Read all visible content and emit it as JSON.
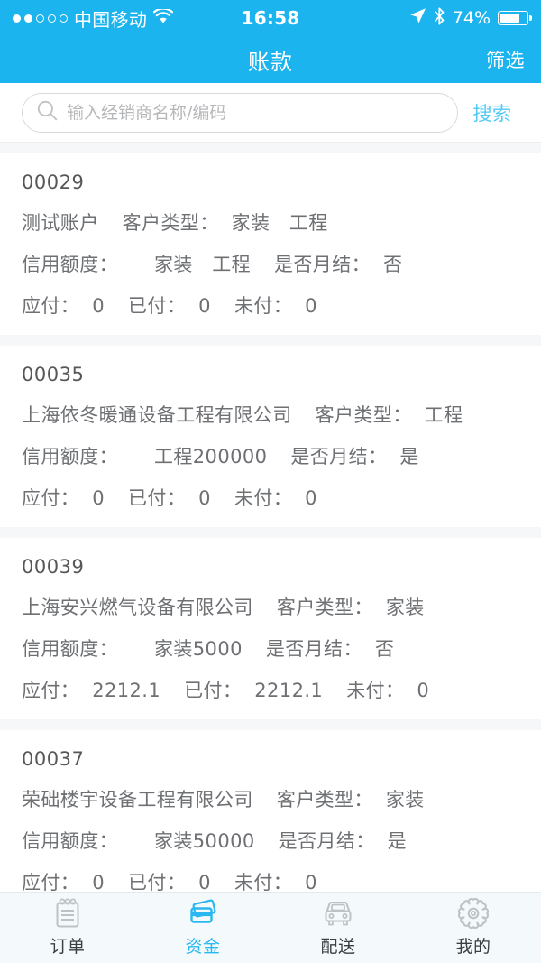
{
  "statusbar": {
    "carrier": "中国移动",
    "signal_filled": 2,
    "signal_total": 5,
    "wifi_icon": "wifi-icon",
    "time": "16:58",
    "location_icon": "location-arrow-icon",
    "bluetooth_icon": "bluetooth-icon",
    "battery_percent": "74%",
    "battery_level": 74
  },
  "navbar": {
    "title": "账款",
    "filter_label": "筛选"
  },
  "search": {
    "placeholder": "输入经销商名称/编码",
    "value": "",
    "icon": "search-icon",
    "button_label": "搜索"
  },
  "labels": {
    "customer_type": "客户类型：",
    "credit_limit": "信用额度：",
    "monthly_settle": "是否月结：",
    "payable": "应付：",
    "paid": "已付：",
    "unpaid": "未付："
  },
  "accounts": [
    {
      "code": "00029",
      "name": "测试账户",
      "customer_type": "家装　工程",
      "credit_limit": "家装　工程",
      "monthly_settle": "否",
      "payable": "0",
      "paid": "0",
      "unpaid": "0"
    },
    {
      "code": "00035",
      "name": "上海依冬暖通设备工程有限公司",
      "customer_type": "工程",
      "credit_limit": "工程200000",
      "monthly_settle": "是",
      "payable": "0",
      "paid": "0",
      "unpaid": "0"
    },
    {
      "code": "00039",
      "name": "上海安兴燃气设备有限公司",
      "customer_type": "家装",
      "credit_limit": "家装5000",
      "monthly_settle": "否",
      "payable": "2212.1",
      "paid": "2212.1",
      "unpaid": "0"
    },
    {
      "code": "00037",
      "name": "荣础楼宇设备工程有限公司",
      "customer_type": "家装",
      "credit_limit": "家装50000",
      "monthly_settle": "是",
      "payable": "0",
      "paid": "0",
      "unpaid": "0"
    }
  ],
  "tabbar": {
    "active_index": 1,
    "tabs": [
      {
        "label": "订单",
        "icon": "notepad-icon"
      },
      {
        "label": "资金",
        "icon": "credit-cards-icon"
      },
      {
        "label": "配送",
        "icon": "delivery-truck-icon"
      },
      {
        "label": "我的",
        "icon": "gear-icon"
      }
    ]
  },
  "colors": {
    "accent": "#1CB4EE",
    "tab_active": "#2BB8F0",
    "search_button": "#52C8F5",
    "text_primary": "#555759",
    "text_secondary": "#6E7073",
    "separator": "#F6F7F8"
  }
}
